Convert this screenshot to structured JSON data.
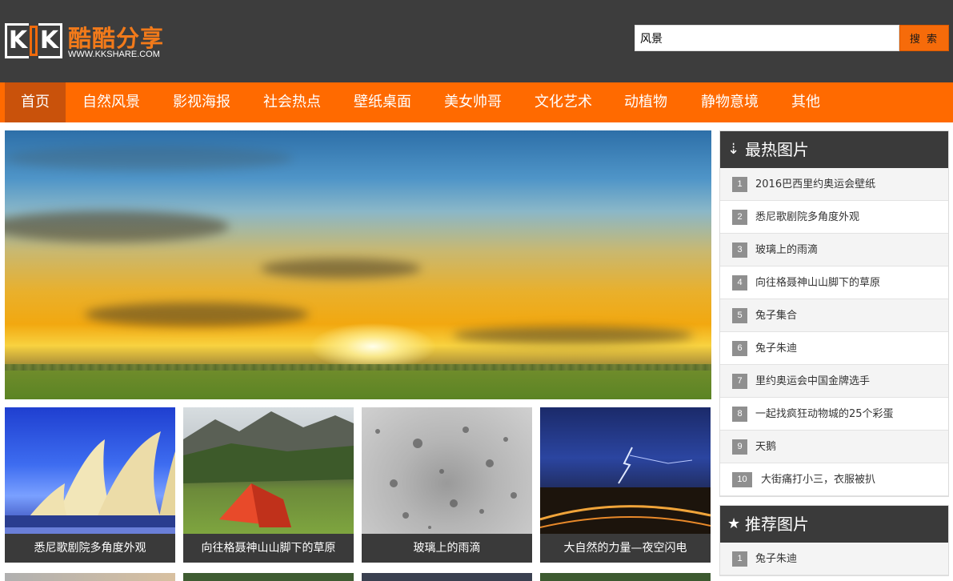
{
  "site": {
    "logo_letter_left": "K",
    "logo_letter_right": "K",
    "logo_cn": "酷酷分享",
    "logo_en": "WWW.KKSHARE.COM",
    "accent": "#ff6a00",
    "header_bg": "#3d3d3d"
  },
  "search": {
    "value": "风景",
    "button_label": "搜 索"
  },
  "nav": {
    "items": [
      {
        "label": "首页",
        "active": true
      },
      {
        "label": "自然风景"
      },
      {
        "label": "影视海报"
      },
      {
        "label": "社会热点"
      },
      {
        "label": "壁纸桌面"
      },
      {
        "label": "美女帅哥"
      },
      {
        "label": "文化艺术"
      },
      {
        "label": "动植物"
      },
      {
        "label": "静物意境"
      },
      {
        "label": "其他"
      }
    ]
  },
  "thumbs": [
    {
      "caption": "悉尼歌剧院多角度外观"
    },
    {
      "caption": "向往格聂神山山脚下的草原"
    },
    {
      "caption": "玻璃上的雨滴"
    },
    {
      "caption": "大自然的力量—夜空闪电"
    }
  ],
  "hot": {
    "icon": "sort-numeric-icon",
    "title": "最热图片",
    "items": [
      {
        "num": "1",
        "text": "2016巴西里约奥运会壁纸"
      },
      {
        "num": "2",
        "text": "悉尼歌剧院多角度外观"
      },
      {
        "num": "3",
        "text": "玻璃上的雨滴"
      },
      {
        "num": "4",
        "text": "向往格聂神山山脚下的草原"
      },
      {
        "num": "5",
        "text": "兔子集合"
      },
      {
        "num": "6",
        "text": "兔子朱迪"
      },
      {
        "num": "7",
        "text": "里约奥运会中国金牌选手"
      },
      {
        "num": "8",
        "text": "一起找疯狂动物城的25个彩蛋"
      },
      {
        "num": "9",
        "text": "天鹅"
      },
      {
        "num": "10",
        "text": "大街痛打小三，衣服被扒"
      }
    ]
  },
  "recommend": {
    "icon": "star-icon",
    "title": "推荐图片",
    "items": [
      {
        "num": "1",
        "text": "兔子朱迪"
      }
    ]
  }
}
